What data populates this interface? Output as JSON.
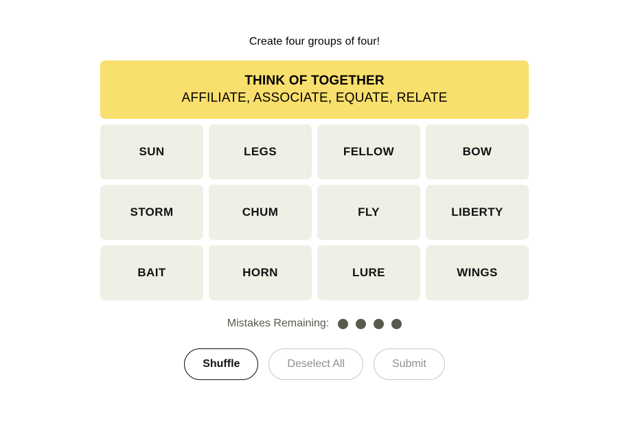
{
  "game": {
    "tagline": "Create four groups of four!",
    "solved_groups": [
      {
        "title": "THINK OF TOGETHER",
        "members": "AFFILIATE, ASSOCIATE, EQUATE, RELATE",
        "color": "#f9df6d"
      }
    ],
    "rows": [
      {
        "tiles": [
          "SUN",
          "LEGS",
          "FELLOW",
          "BOW"
        ]
      },
      {
        "tiles": [
          "STORM",
          "CHUM",
          "FLY",
          "LIBERTY"
        ]
      },
      {
        "tiles": [
          "BAIT",
          "HORN",
          "LURE",
          "WINGS"
        ]
      }
    ],
    "mistakes": {
      "label": "Mistakes Remaining:",
      "remaining": 4,
      "dot_color": "#5a594e"
    },
    "actions": {
      "shuffle": "Shuffle",
      "deselect": "Deselect All",
      "submit": "Submit"
    },
    "colors": {
      "tile_background": "#efefe6",
      "page_background": "#ffffff",
      "text": "#121212"
    }
  }
}
